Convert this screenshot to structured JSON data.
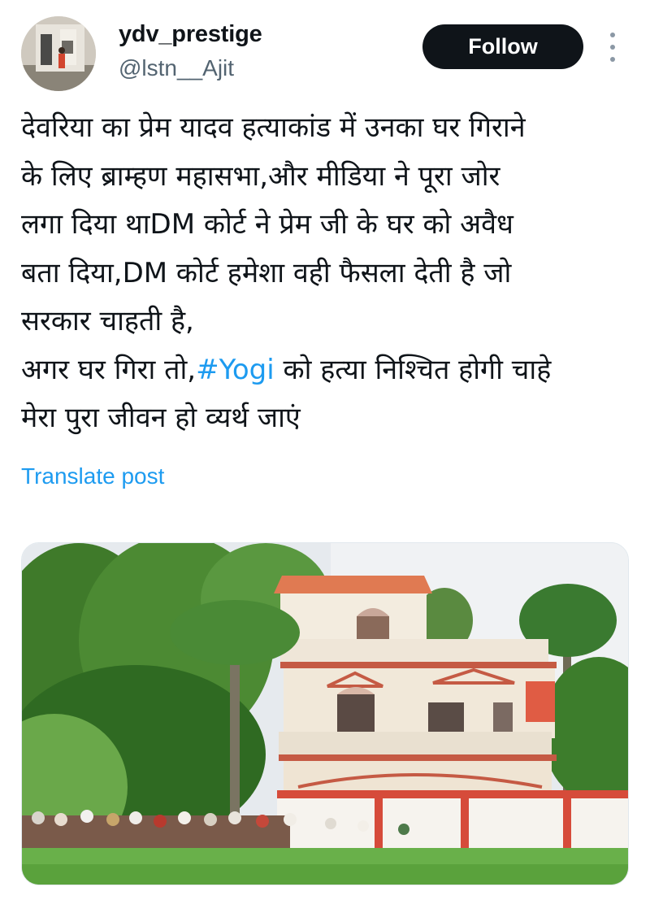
{
  "author": {
    "display_name": "ydv_prestige",
    "handle": "@lstn__Ajit",
    "avatar_icon": "profile-photo"
  },
  "actions": {
    "follow_label": "Follow",
    "more_icon": "vertical-ellipsis-icon"
  },
  "post": {
    "lines": [
      "देवरिया का प्रेम यादव हत्याकांड में उनका घर गिराने",
      "के लिए ब्राम्हण महासभा,और मीडिया ने पूरा जोर",
      "लगा दिया थाDM कोर्ट ने प्रेम जी के घर को अवैध",
      "बता दिया,DM कोर्ट हमेशा वही फैसला देती है जो",
      "सरकार चाहती है,"
    ],
    "line6_before": "अगर घर गिरा तो,",
    "hashtag": "#Yogi",
    "line6_after": " को हत्या निश्चित होगी चाहे",
    "line7": "मेरा पुरा जीवन हो व्यर्थ जाएं"
  },
  "translate_label": "Translate post",
  "colors": {
    "accent": "#1d9bf0",
    "text": "#0f1419",
    "secondary": "#536471",
    "follow_bg": "#0f1419"
  }
}
